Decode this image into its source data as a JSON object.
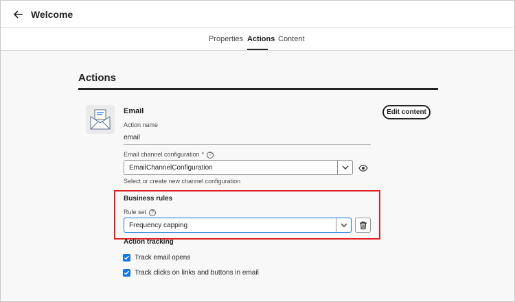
{
  "header": {
    "title": "Welcome",
    "back_icon": "arrow-left-icon"
  },
  "tabs": [
    {
      "label": "Properties",
      "active": false
    },
    {
      "label": "Actions",
      "active": true
    },
    {
      "label": "Content",
      "active": false
    }
  ],
  "section": {
    "title": "Actions"
  },
  "action": {
    "type_label": "Email",
    "edit_button": "Edit content",
    "action_name_label": "Action name",
    "action_name_value": "email",
    "channel_config_label": "Email channel configuration",
    "channel_config_required": "*",
    "channel_config_value": "EmailChannelConfiguration",
    "channel_config_help": "Select or create new channel configuration"
  },
  "business_rules": {
    "title": "Business rules",
    "rule_set_label": "Rule set",
    "rule_set_value": "Frequency capping"
  },
  "tracking": {
    "title": "Action tracking",
    "options": [
      {
        "label": "Track email opens",
        "checked": true
      },
      {
        "label": "Track clicks on links and buttons in email",
        "checked": true
      }
    ]
  },
  "colors": {
    "accent": "#1473e6",
    "highlight": "#e01f1f"
  }
}
